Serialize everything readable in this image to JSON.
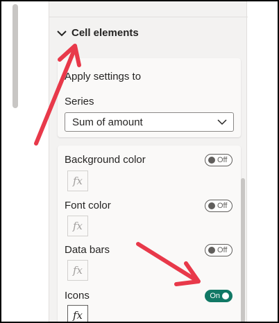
{
  "section": {
    "title": "Cell elements"
  },
  "apply_settings": {
    "title": "Apply settings to",
    "series_label": "Series",
    "series_value": "Sum of amount"
  },
  "settings": [
    {
      "label": "Background color",
      "toggle": "Off",
      "on": false
    },
    {
      "label": "Font color",
      "toggle": "Off",
      "on": false
    },
    {
      "label": "Data bars",
      "toggle": "Off",
      "on": false
    },
    {
      "label": "Icons",
      "toggle": "On",
      "on": true
    }
  ],
  "fx_label": "fx",
  "colors": {
    "toggle_on": "#117865",
    "annotation_arrow": "#e8394a"
  }
}
